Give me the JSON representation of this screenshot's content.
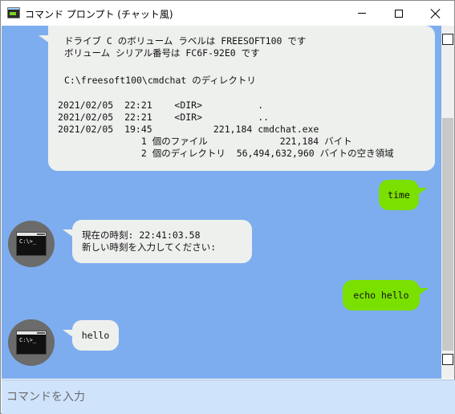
{
  "window": {
    "title": "コマンド プロンプト (チャット風)"
  },
  "messages": {
    "dir_output": {
      "line1": "ドライブ C のボリューム ラベルは FREESOFT100 です\nボリューム シリアル番号は FC6F-92E0 です",
      "line2": "C:\\freesoft100\\cmdchat のディレクトリ",
      "listing": "2021/02/05  22:21    <DIR>          .\n2021/02/05  22:21    <DIR>          ..\n2021/02/05  19:45           221,184 cmdchat.exe\n               1 個のファイル             221,184 バイト\n               2 個のディレクトリ  56,494,632,960 バイトの空き領域"
    },
    "user_time": "time",
    "time_output": "現在の時刻: 22:41:03.58\n新しい時刻を入力してください:",
    "user_echo": "echo hello",
    "echo_output": "hello",
    "avatar_text": "C:\\>_"
  },
  "input": {
    "placeholder": "コマンドを入力",
    "value": ""
  },
  "colors": {
    "chat_background": "#7dadee",
    "user_bubble": "#7ae000",
    "bot_bubble": "#eef0ee",
    "input_background": "#cfe3fb"
  }
}
